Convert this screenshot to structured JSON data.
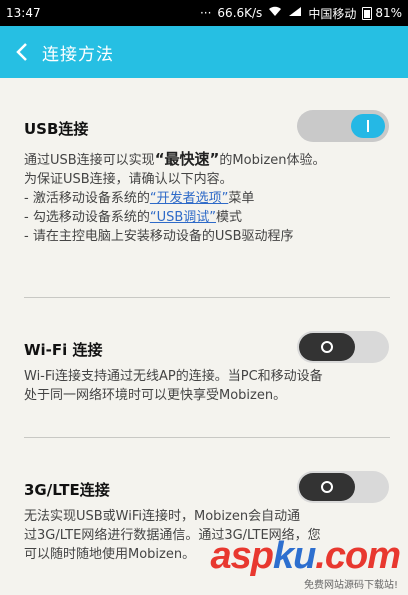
{
  "status_bar": {
    "time": "13:47",
    "dots": "···",
    "speed": "66.6K/s",
    "carrier": "中国移动",
    "battery": "81%",
    "battery_level_pct": 81
  },
  "app_bar": {
    "title": "连接方法"
  },
  "usb": {
    "title": "USB连接",
    "toggle_state": "on",
    "line1_pre": "通过USB连接可以实现",
    "line1_emph": "“最快速”",
    "line1_post": "的Mobizen体验。",
    "line2": "为保证USB连接，请确认以下内容。",
    "step1_pre": "- 激活移动设备系统的",
    "step1_link": "“开发者选项”",
    "step1_post": "菜单",
    "step2_pre": "- 勾选移动设备系统的",
    "step2_link": "“USB调试”",
    "step2_post": "模式",
    "step3": "- 请在主控电脑上安装移动设备的USB驱动程序"
  },
  "wifi": {
    "title": "Wi-Fi 连接",
    "toggle_state": "off",
    "desc1": "Wi-Fi连接支持通过无线AP的连接。当PC和移动设备",
    "desc2": "处于同一网络环境时可以更快享受Mobizen。"
  },
  "lte": {
    "title": "3G/LTE连接",
    "toggle_state": "off",
    "desc1": "无法实现USB或WiFi连接时，Mobizen会自动通",
    "desc2": "过3G/LTE网络进行数据通信。通过3G/LTE网络，您",
    "desc3": "可以随时随地使用Mobizen。"
  },
  "watermark": {
    "text_red": "asp",
    "text_blue": "ku",
    "text_end": ".com",
    "sub": "免费网站源码下载站!"
  },
  "colors": {
    "accent": "#26bfe3",
    "link": "#2e6ac8"
  }
}
